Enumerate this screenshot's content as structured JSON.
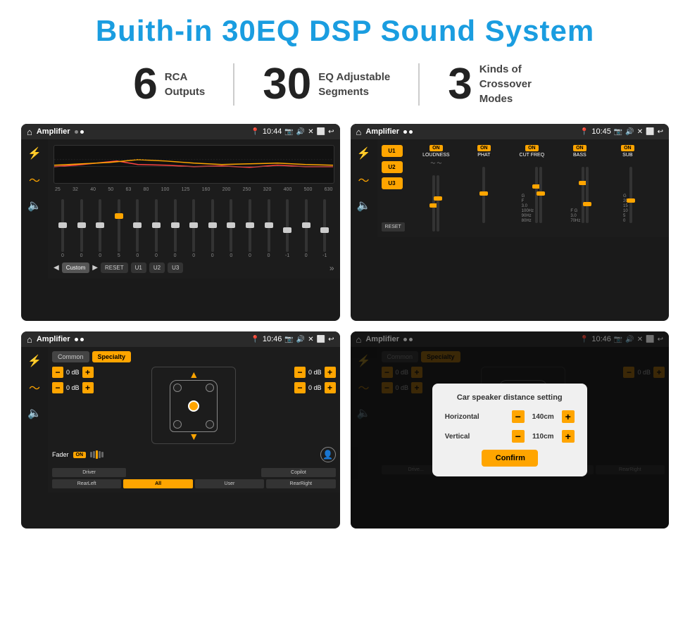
{
  "page": {
    "title": "Buith-in 30EQ DSP Sound System",
    "stats": [
      {
        "number": "6",
        "label": "RCA\nOutputs"
      },
      {
        "number": "30",
        "label": "EQ Adjustable\nSegments"
      },
      {
        "number": "3",
        "label": "Kinds of\nCrossover Modes"
      }
    ]
  },
  "screen1": {
    "status": {
      "app": "Amplifier",
      "time": "10:44",
      "icon1": "⌂"
    },
    "freqs": [
      "25",
      "32",
      "40",
      "50",
      "63",
      "80",
      "100",
      "125",
      "160",
      "200",
      "250",
      "320",
      "400",
      "500",
      "630"
    ],
    "sliderVals": [
      "0",
      "0",
      "0",
      "5",
      "0",
      "0",
      "0",
      "0",
      "0",
      "0",
      "0",
      "0",
      "-1",
      "0",
      "-1"
    ],
    "sliderPos": [
      50,
      50,
      50,
      35,
      50,
      50,
      50,
      50,
      50,
      50,
      50,
      50,
      60,
      50,
      60
    ],
    "bottomBtns": [
      "Custom",
      "RESET",
      "U1",
      "U2",
      "U3"
    ]
  },
  "screen2": {
    "status": {
      "app": "Amplifier",
      "time": "10:45"
    },
    "presets": [
      "U1",
      "U2",
      "U3"
    ],
    "cols": [
      {
        "on": "ON",
        "label": "LOUDNESS"
      },
      {
        "on": "ON",
        "label": "PHAT"
      },
      {
        "on": "ON",
        "label": "CUT FREQ"
      },
      {
        "on": "ON",
        "label": "BASS"
      },
      {
        "on": "ON",
        "label": "SUB"
      }
    ],
    "resetLabel": "RESET"
  },
  "screen3": {
    "status": {
      "app": "Amplifier",
      "time": "10:46"
    },
    "tabs": [
      "Common",
      "Specialty"
    ],
    "activeTab": "Specialty",
    "fader": {
      "label": "Fader",
      "on": "ON"
    },
    "volumeRows": [
      {
        "val": "0 dB"
      },
      {
        "val": "0 dB"
      },
      {
        "val": "0 dB"
      },
      {
        "val": "0 dB"
      }
    ],
    "bottomBtns": [
      "Driver",
      "",
      "",
      "",
      "Copilot",
      "RearLeft",
      "All",
      "",
      "User",
      "RearRight"
    ]
  },
  "screen4": {
    "status": {
      "app": "Amplifier",
      "time": "10:46"
    },
    "tabs": [
      "Common",
      "Specialty"
    ],
    "dialog": {
      "title": "Car speaker distance setting",
      "rows": [
        {
          "label": "Horizontal",
          "value": "140cm"
        },
        {
          "label": "Vertical",
          "value": "110cm"
        }
      ],
      "confirmLabel": "Confirm"
    },
    "volumeRows": [
      {
        "val": "0 dB"
      },
      {
        "val": "0 dB"
      }
    ]
  }
}
